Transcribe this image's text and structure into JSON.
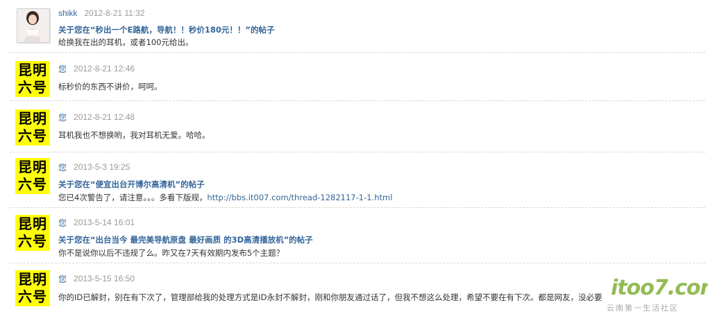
{
  "posts": [
    {
      "avatar": "photo",
      "author": "shikk",
      "time": "2012-8-21 11:32",
      "subject": "关于您在“秒出一个E路航，导航！！秒价180元！！”的帖子",
      "body": "给换我在出的耳机，或者100元给出。"
    },
    {
      "avatar": "text",
      "avatar_line1": "昆明",
      "avatar_line2": "六号",
      "author": "您",
      "time": "2012-8-21 12:46",
      "body": "标秒价的东西不讲价，呵呵。"
    },
    {
      "avatar": "text",
      "avatar_line1": "昆明",
      "avatar_line2": "六号",
      "author": "您",
      "time": "2012-8-21 12:48",
      "body": "耳机我也不想换哟，我对耳机无爱。哈哈。"
    },
    {
      "avatar": "text",
      "avatar_line1": "昆明",
      "avatar_line2": "六号",
      "author": "您",
      "time": "2013-5-3 19:25",
      "subject": "关于您在“便宜出台开博尔高清机”的帖子",
      "body": "您已4次警告了，请注意。。。多看下版规，",
      "link": "http://bbs.it007.com/thread-1282117-1-1.html"
    },
    {
      "avatar": "text",
      "avatar_line1": "昆明",
      "avatar_line2": "六号",
      "author": "您",
      "time": "2013-5-14 16:01",
      "subject": "关于您在“出台当今 最完美导航原盘 最好画质 的3D高清播放机”的帖子",
      "body": "你不是说你以后不违规了么。昨又在7天有效期内发布5个主题？"
    },
    {
      "avatar": "text",
      "avatar_line1": "昆明",
      "avatar_line2": "六号",
      "author": "您",
      "time": "2013-5-15 16:50",
      "body": "你的ID已解封，别在有下次了，管理部给我的处理方式是ID永封不解封，刚和你朋友通过话了，但我不想这么处理，希望不要在有下次。都是网友，没必要"
    }
  ],
  "watermark": {
    "main": "itoo7.com",
    "sub": "云南第一生活社区"
  },
  "colors": {
    "link": "#336699",
    "avatar_bg": "#fffe0a",
    "time": "#999999",
    "body": "#333333"
  }
}
